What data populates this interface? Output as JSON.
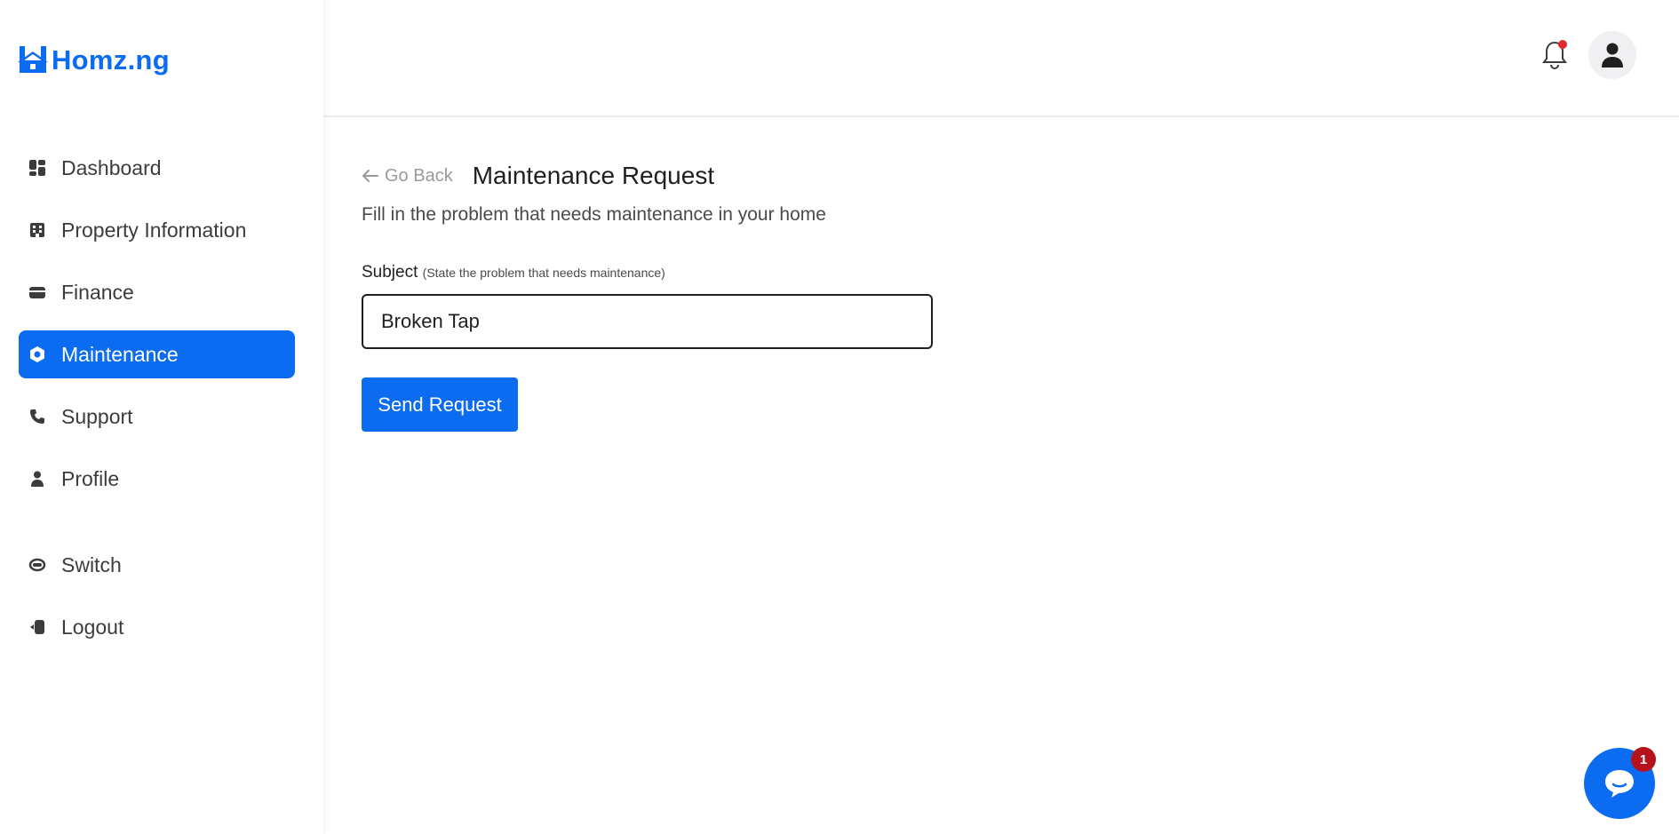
{
  "brand": {
    "name": "Homz.ng",
    "color": "#0b6cf2"
  },
  "sidebar": {
    "items": [
      {
        "label": "Dashboard",
        "icon": "dashboard-grid-icon",
        "active": false
      },
      {
        "label": "Property Information",
        "icon": "building-icon",
        "active": false
      },
      {
        "label": "Finance",
        "icon": "wallet-icon",
        "active": false
      },
      {
        "label": "Maintenance",
        "icon": "gear-nut-icon",
        "active": true
      },
      {
        "label": "Support",
        "icon": "phone-icon",
        "active": false
      },
      {
        "label": "Profile",
        "icon": "user-icon",
        "active": false
      },
      {
        "label": "Switch",
        "icon": "switch-icon",
        "active": false
      },
      {
        "label": "Logout",
        "icon": "logout-door-icon",
        "active": false
      }
    ]
  },
  "header": {
    "notifications_icon": "bell-icon",
    "has_unread": true,
    "profile_icon": "user-avatar-icon"
  },
  "main": {
    "go_back_label": "Go Back",
    "title": "Maintenance Request",
    "subtitle": "Fill in the problem that needs maintenance in your home",
    "subject_label": "Subject",
    "subject_hint": "(State the problem that needs maintenance)",
    "subject_value": "Broken Tap",
    "submit_label": "Send Request"
  },
  "chat_widget": {
    "icon": "chat-bubble-icon",
    "badge_count": "1"
  },
  "colors": {
    "accent": "#0b6cf2",
    "badge": "#b5121b",
    "notification_dot": "#e0282e"
  }
}
